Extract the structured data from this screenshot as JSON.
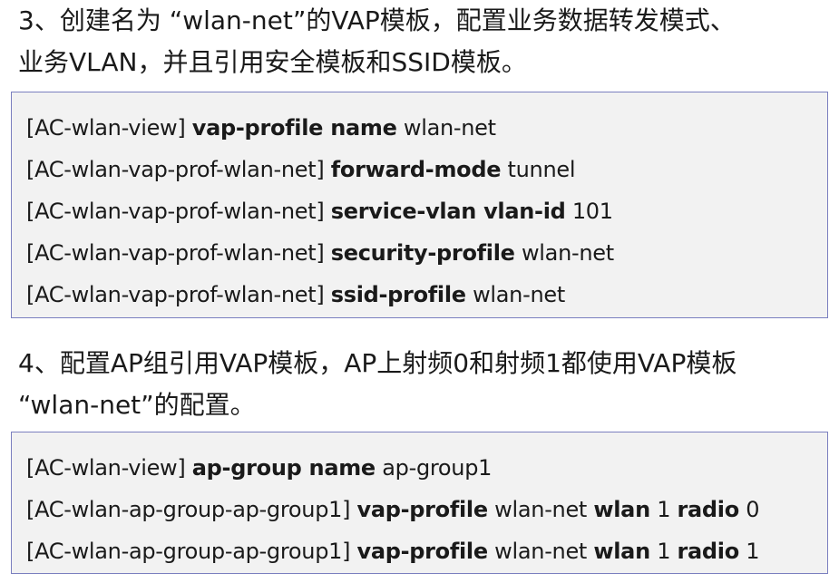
{
  "section3": {
    "title_line1": "3、创建名为 “wlan-net”的VAP模板，配置业务数据转发模式、",
    "title_line2": "业务VLAN，并且引用安全模板和SSID模板。",
    "commands": [
      {
        "prompt": "[AC-wlan-view] ",
        "parts": [
          {
            "text": "vap-profile name",
            "bold": true
          },
          {
            "text": " wlan-net",
            "bold": false
          }
        ]
      },
      {
        "prompt": "[AC-wlan-vap-prof-wlan-net] ",
        "parts": [
          {
            "text": "forward-mode",
            "bold": true
          },
          {
            "text": " tunnel",
            "bold": false
          }
        ]
      },
      {
        "prompt": "[AC-wlan-vap-prof-wlan-net] ",
        "parts": [
          {
            "text": "service-vlan vlan-id",
            "bold": true
          },
          {
            "text": " 101",
            "bold": false
          }
        ]
      },
      {
        "prompt": "[AC-wlan-vap-prof-wlan-net] ",
        "parts": [
          {
            "text": "security-profile",
            "bold": true
          },
          {
            "text": " wlan-net",
            "bold": false
          }
        ]
      },
      {
        "prompt": "[AC-wlan-vap-prof-wlan-net] ",
        "parts": [
          {
            "text": "ssid-profile",
            "bold": true
          },
          {
            "text": " wlan-net",
            "bold": false
          }
        ]
      }
    ]
  },
  "section4": {
    "title_line1": "4、配置AP组引用VAP模板，AP上射频0和射频1都使用VAP模板",
    "title_line2": "“wlan-net”的配置。",
    "commands": [
      {
        "prompt": "[AC-wlan-view] ",
        "parts": [
          {
            "text": "ap-group name",
            "bold": true
          },
          {
            "text": " ap-group1",
            "bold": false
          }
        ]
      },
      {
        "prompt": "[AC-wlan-ap-group-ap-group1] ",
        "parts": [
          {
            "text": "vap-profile",
            "bold": true
          },
          {
            "text": " wlan-net ",
            "bold": false
          },
          {
            "text": "wlan",
            "bold": true
          },
          {
            "text": " 1 ",
            "bold": false
          },
          {
            "text": "radio",
            "bold": true
          },
          {
            "text": " 0",
            "bold": false
          }
        ]
      },
      {
        "prompt": "[AC-wlan-ap-group-ap-group1] ",
        "parts": [
          {
            "text": "vap-profile",
            "bold": true
          },
          {
            "text": " wlan-net ",
            "bold": false
          },
          {
            "text": "wlan",
            "bold": true
          },
          {
            "text": " 1 ",
            "bold": false
          },
          {
            "text": "radio",
            "bold": true
          },
          {
            "text": " 1",
            "bold": false
          }
        ]
      }
    ]
  }
}
